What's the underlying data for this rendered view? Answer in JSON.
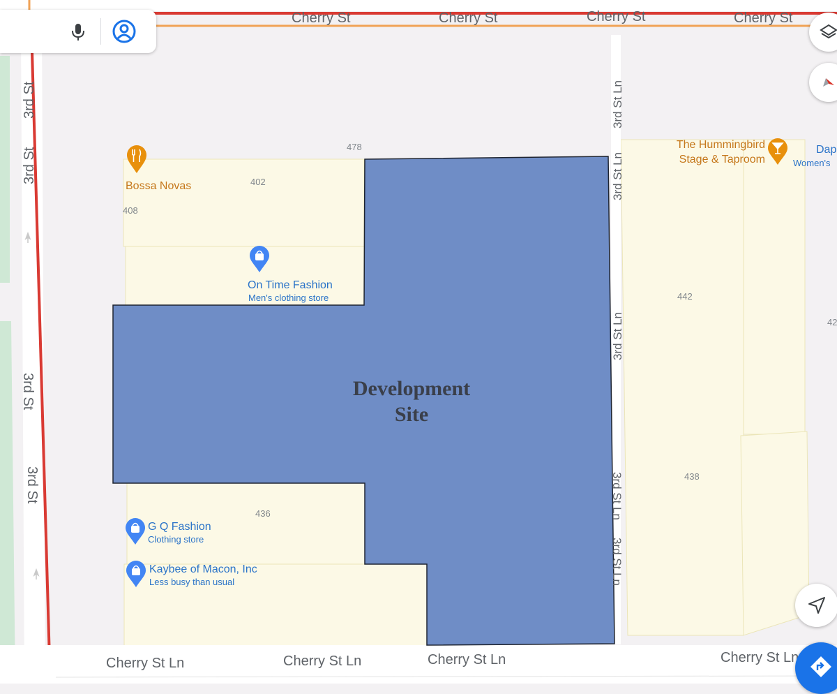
{
  "streets": {
    "top": [
      "Cherry St",
      "Cherry St",
      "Cherry St",
      "Cherry St"
    ],
    "top_cut": "t",
    "left": [
      "3rd St",
      "3rd St",
      "3rd St",
      "3rd St"
    ],
    "middle": [
      "3rd St Ln",
      "3rd St Ln",
      "3rd St Ln",
      "3rd St Ln",
      "3rd St Ln"
    ],
    "bottom": [
      "Cherry St Ln",
      "Cherry St Ln",
      "Cherry St Ln",
      "Cherry St Ln"
    ]
  },
  "numbers": {
    "n478": "478",
    "n402": "402",
    "n408": "408",
    "n436": "436",
    "n442": "442",
    "n438": "438",
    "n42": "42"
  },
  "development_site": {
    "line1": "Development",
    "line2": "Site",
    "fill_color": "#6f8dc6"
  },
  "places": {
    "bossa_novas": {
      "name": "Bossa Novas",
      "icon": "restaurant-icon"
    },
    "on_time_fashion": {
      "name": "On Time Fashion",
      "category": "Men's clothing store",
      "icon": "shopping-bag-icon"
    },
    "gq_fashion": {
      "name": "G Q Fashion",
      "category": "Clothing store",
      "icon": "shopping-bag-icon"
    },
    "kaybee": {
      "name": "Kaybee of Macon, Inc",
      "status": "Less busy than usual",
      "icon": "shopping-bag-icon"
    },
    "hummingbird": {
      "name_line1": "The Hummingbird",
      "name_line2": "Stage & Taproom",
      "icon": "bar-icon"
    },
    "dap": {
      "name": "Dap",
      "category": "Women's"
    }
  },
  "colors": {
    "major_road": "#d93a33",
    "secondary_road": "#f0a256",
    "building": "#fcf9e6",
    "park": "#cfe8d5",
    "poi_orange": "#e8900c",
    "poi_blue": "#4285f4"
  },
  "controls": {
    "mic": "mic-icon",
    "account": "account-icon",
    "layers": "layers-icon",
    "compass": "compass-icon",
    "my_location": "my-location-icon",
    "directions": "directions-icon"
  }
}
